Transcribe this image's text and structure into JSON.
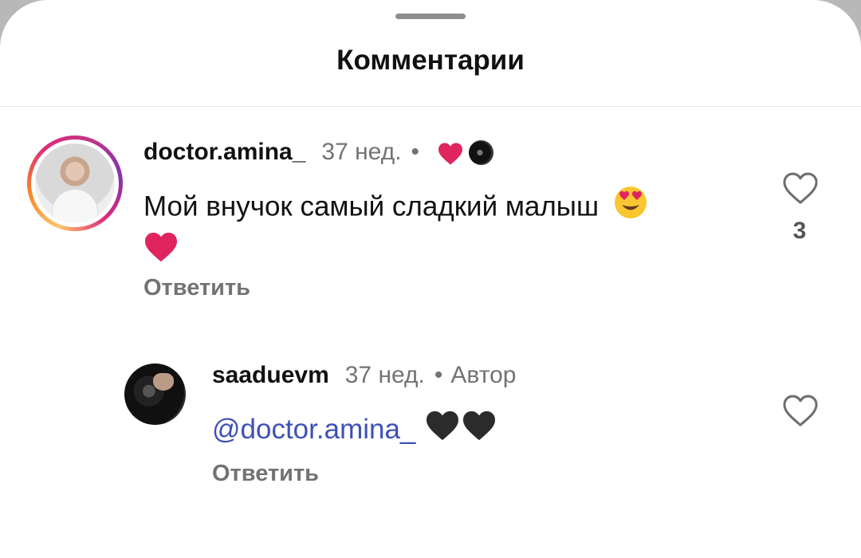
{
  "sheet": {
    "title": "Комментарии"
  },
  "comments": [
    {
      "username": "doctor.amina_",
      "time": "37 нед.",
      "separator": "•",
      "text": "Мой внучок самый сладкий  малыш",
      "reply_label": "Ответить",
      "like_count": "3",
      "emojis": [
        "smiling-face-with-heart-eyes",
        "red-heart"
      ],
      "liked_by_author": true
    },
    {
      "username": "saaduevm",
      "time": "37 нед.",
      "separator": "•",
      "author_label": "Автор",
      "mention": "@doctor.amina_",
      "reply_label": "Ответить",
      "emojis": [
        "black-heart",
        "black-heart"
      ]
    }
  ],
  "colors": {
    "mention": "#3f51b5",
    "heart_red": "#e0245e",
    "secondary_text": "#737373"
  }
}
